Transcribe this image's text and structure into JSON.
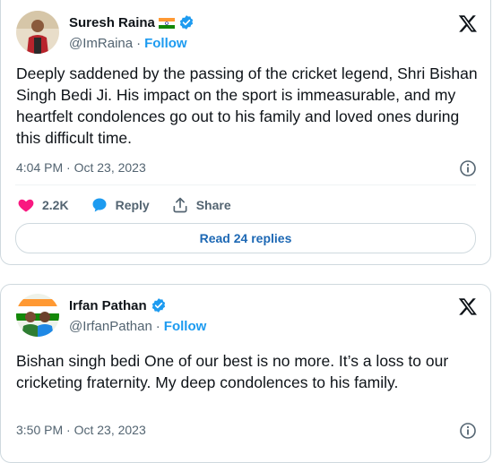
{
  "tweets": [
    {
      "name": "Suresh Raina",
      "handle": "@ImRaina",
      "separator": "·",
      "follow_label": "Follow",
      "text": "Deeply saddened by the passing of the cricket legend, Shri Bishan Singh Bedi Ji. His impact on the sport is immeasurable, and my heartfelt condolences go out to his family and loved ones during this difficult time.",
      "timestamp": "4:04 PM · Oct 23, 2023",
      "likes": "2.2K",
      "reply_label": "Reply",
      "share_label": "Share",
      "read_replies_label": "Read 24 replies"
    },
    {
      "name": "Irfan Pathan",
      "handle": "@IrfanPathan",
      "separator": "·",
      "follow_label": "Follow",
      "text": "Bishan singh bedi One of our best is no more. It’s a loss to our cricketing fraternity. My deep condolences to his family.",
      "timestamp": "3:50 PM · Oct 23, 2023"
    }
  ],
  "colors": {
    "accent": "#1d9bf0",
    "like": "#f91880",
    "text_secondary": "#536471",
    "border": "#cfd9de"
  },
  "icons": [
    "x-logo-icon",
    "verified-badge-icon",
    "india-flag-icon",
    "heart-icon",
    "reply-bubble-icon",
    "share-icon",
    "info-icon"
  ]
}
